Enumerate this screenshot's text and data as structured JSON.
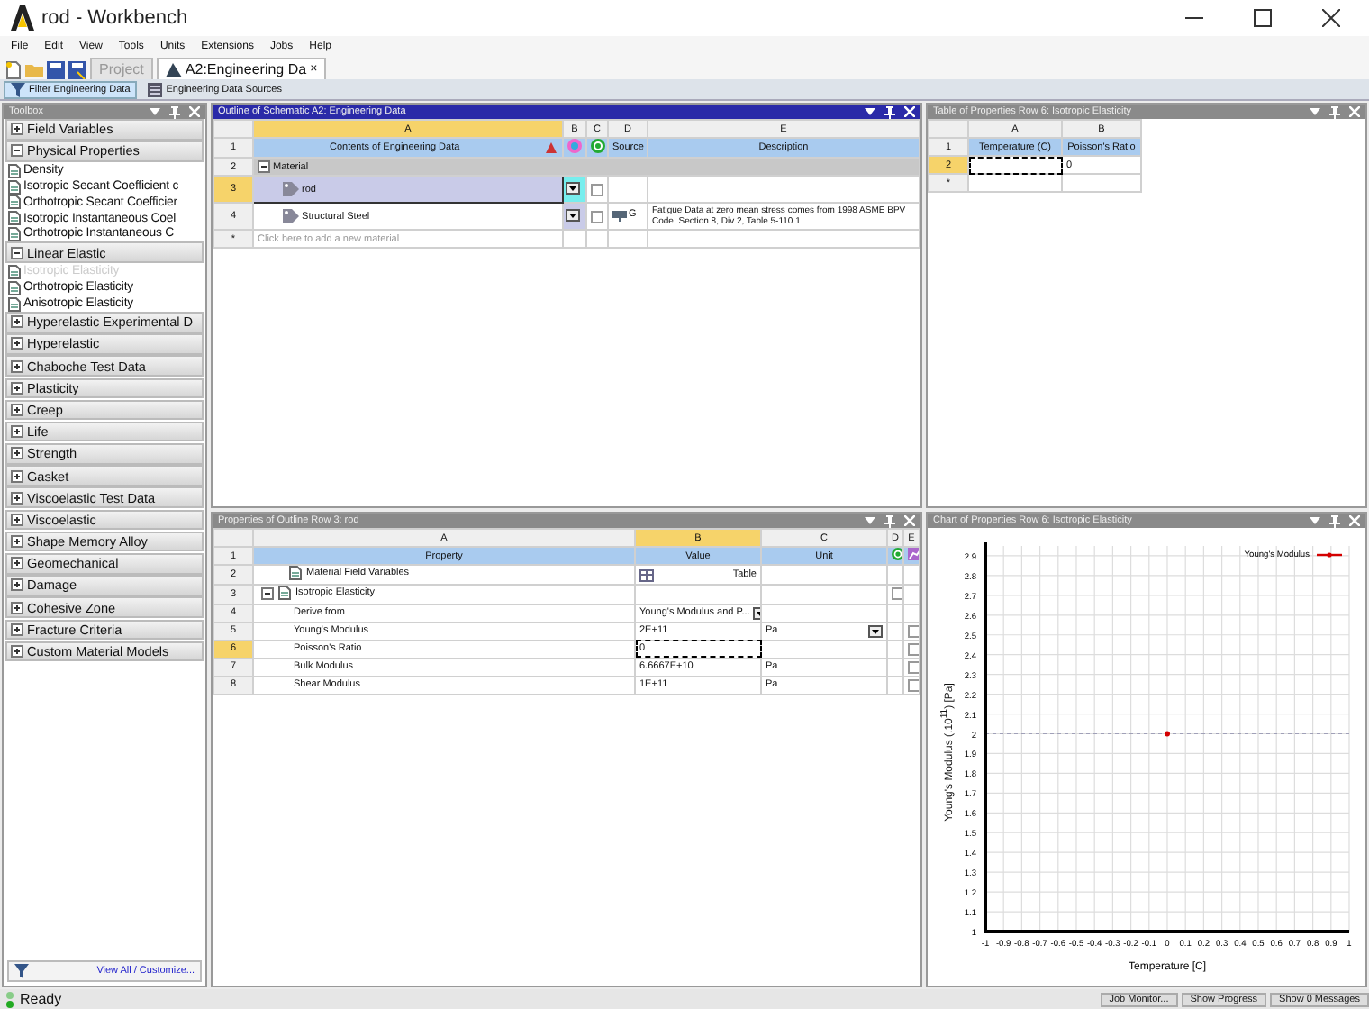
{
  "window": {
    "title": "rod - Workbench"
  },
  "menu": [
    "File",
    "Edit",
    "View",
    "Tools",
    "Units",
    "Extensions",
    "Jobs",
    "Help"
  ],
  "tabs": [
    {
      "label": "Project",
      "selected": false
    },
    {
      "label": "A2:Engineering Da",
      "selected": true,
      "close": "×"
    }
  ],
  "subtoolbar": [
    {
      "label": "Filter Engineering Data",
      "selected": true
    },
    {
      "label": "Engineering Data Sources",
      "selected": false
    }
  ],
  "toolbox": {
    "title": "Toolbox",
    "active": false,
    "categories": [
      {
        "label": "Field Variables",
        "expanded": false
      },
      {
        "label": "Physical Properties",
        "expanded": true,
        "children": [
          {
            "label": "Density",
            "disabled": false
          },
          {
            "label": "Isotropic Secant Coefficient c",
            "disabled": false
          },
          {
            "label": "Orthotropic Secant Coefficier",
            "disabled": false
          },
          {
            "label": "Isotropic Instantaneous Coel",
            "disabled": false
          },
          {
            "label": "Orthotropic Instantaneous C",
            "disabled": false
          }
        ]
      },
      {
        "label": "Linear Elastic",
        "expanded": true,
        "children": [
          {
            "label": "Isotropic Elasticity",
            "disabled": true
          },
          {
            "label": "Orthotropic Elasticity",
            "disabled": false
          },
          {
            "label": "Anisotropic Elasticity",
            "disabled": false
          }
        ]
      },
      {
        "label": "Hyperelastic Experimental D",
        "expanded": false
      },
      {
        "label": "Hyperelastic",
        "expanded": false
      },
      {
        "label": "Chaboche Test Data",
        "expanded": false
      },
      {
        "label": "Plasticity",
        "expanded": false
      },
      {
        "label": "Creep",
        "expanded": false
      },
      {
        "label": "Life",
        "expanded": false
      },
      {
        "label": "Strength",
        "expanded": false
      },
      {
        "label": "Gasket",
        "expanded": false
      },
      {
        "label": "Viscoelastic Test Data",
        "expanded": false
      },
      {
        "label": "Viscoelastic",
        "expanded": false
      },
      {
        "label": "Shape Memory Alloy",
        "expanded": false
      },
      {
        "label": "Geomechanical",
        "expanded": false
      },
      {
        "label": "Damage",
        "expanded": false
      },
      {
        "label": "Cohesive Zone",
        "expanded": false
      },
      {
        "label": "Fracture Criteria",
        "expanded": false
      },
      {
        "label": "Custom Material Models",
        "expanded": false
      }
    ],
    "footer": "View All / Customize..."
  },
  "outline": {
    "title": "Outline of Schematic A2: Engineering Data",
    "active": true,
    "columns": [
      "A",
      "B",
      "C",
      "D",
      "E"
    ],
    "header": {
      "row": "1",
      "contents": "Contents of Engineering Data",
      "source": "Source",
      "description": "Description"
    },
    "rows": [
      {
        "kind": "group",
        "row": "2",
        "label": "Material",
        "expanded": true,
        "selected": false
      },
      {
        "kind": "material",
        "row": "3",
        "label": "rod",
        "selected": true,
        "check": false
      },
      {
        "kind": "material",
        "row": "4",
        "label": "Structural Steel",
        "selected": false,
        "check": false,
        "source": "G",
        "description": "Fatigue Data at zero mean stress comes from 1998 ASME BPV Code, Section 8, Div 2, Table 5-110.1"
      },
      {
        "kind": "new",
        "row": "*",
        "label": "Click here to add a new material",
        "selected": false
      }
    ]
  },
  "table": {
    "title": "Table of Properties Row 6: Isotropic Elasticity",
    "active": false,
    "columns": [
      "A",
      "B"
    ],
    "header": {
      "row": "1",
      "temperature": "Temperature (C)",
      "poissons_ratio": "Poisson's Ratio"
    },
    "rows": [
      {
        "row": "2",
        "selected": true,
        "poissons_ratio": "0"
      },
      {
        "row": "*",
        "selected": false
      }
    ]
  },
  "properties": {
    "title": "Properties of Outline Row 3: rod",
    "active": false,
    "columns": [
      "A",
      "B",
      "C",
      "D",
      "E"
    ],
    "header": {
      "row": "1",
      "property": "Property",
      "value": "Value",
      "unit": "Unit"
    },
    "rows": [
      {
        "kind": "group",
        "row": "2",
        "property": "Material Field Variables",
        "value": "Table",
        "selected": false
      },
      {
        "kind": "group",
        "row": "3",
        "property": "Isotropic Elasticity",
        "expanded": true,
        "selected": false,
        "check": false
      },
      {
        "kind": "item",
        "row": "4",
        "property": "Derive from",
        "value": "Young's Modulus and P...",
        "value_dropdown": true,
        "selected": false
      },
      {
        "kind": "item",
        "row": "5",
        "property": "Young's Modulus",
        "value": "2E+11",
        "unit": "Pa",
        "unit_dropdown": true,
        "selected": false,
        "check": false
      },
      {
        "kind": "item",
        "row": "6",
        "property": "Poisson's Ratio",
        "value": "0",
        "selected": true,
        "check": false
      },
      {
        "kind": "item",
        "row": "7",
        "property": "Bulk Modulus",
        "value": "6.6667E+10",
        "unit": "Pa",
        "selected": false,
        "check": false
      },
      {
        "kind": "item",
        "row": "8",
        "property": "Shear Modulus",
        "value": "1E+11",
        "unit": "Pa",
        "selected": false,
        "check": false
      }
    ]
  },
  "chart": {
    "title": "Chart of Properties Row 6: Isotropic Elasticity",
    "active": false,
    "chart_data": {
      "type": "line",
      "xlabel": "Temperature  [C]",
      "ylabel": "Young's Modulus  (.10$^{11}$)  [Pa]",
      "x": [
        0
      ],
      "series": [
        {
          "name": "Young's Modulus",
          "color": "#d40000",
          "marker": "circle",
          "values": [
            2
          ]
        }
      ],
      "grid": true,
      "ref_lines": [
        {
          "axis": "y",
          "value": 2
        }
      ],
      "xlim": [
        -1,
        1
      ],
      "ylim": [
        1,
        2.95
      ],
      "xticks": [
        -1,
        -0.9,
        -0.8,
        -0.7,
        -0.6,
        -0.5,
        -0.4,
        -0.3,
        -0.2,
        -0.1,
        0,
        0.1,
        0.2,
        0.3,
        0.4,
        0.5,
        0.6,
        0.7,
        0.8,
        0.9,
        1
      ],
      "yticks": [
        1,
        1.1,
        1.2,
        1.3,
        1.4,
        1.5,
        1.6,
        1.7,
        1.8,
        1.9,
        2,
        2.1,
        2.2,
        2.3,
        2.4,
        2.5,
        2.6,
        2.7,
        2.8,
        2.9
      ]
    }
  },
  "status_bar": {
    "text": "Ready",
    "buttons": [
      "Job Monitor...",
      "Show Progress",
      "Show 0 Messages"
    ]
  }
}
